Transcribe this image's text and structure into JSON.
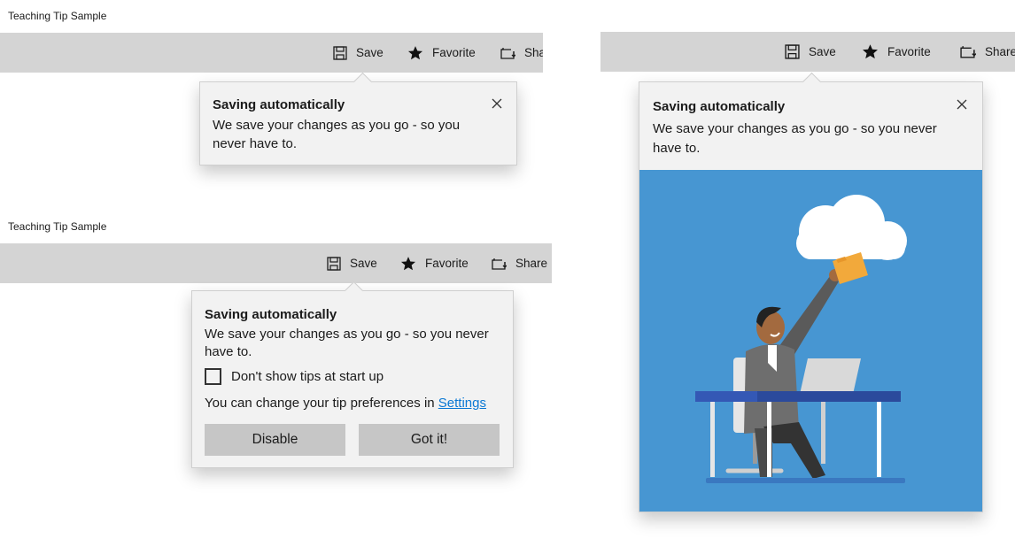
{
  "samples": [
    {
      "caption": "Teaching Tip Sample",
      "toolbar": {
        "items": [
          {
            "icon": "save-icon",
            "label": "Save"
          },
          {
            "icon": "star-icon",
            "label": "Favorite"
          },
          {
            "icon": "share-icon",
            "label": "Share"
          }
        ]
      },
      "tip": {
        "title": "Saving automatically",
        "subtitle": "We save your changes as you go - so you never have to.",
        "close_icon": "close-icon"
      }
    },
    {
      "caption": "Teaching Tip Sample",
      "toolbar": {
        "items": [
          {
            "icon": "save-icon",
            "label": "Save"
          },
          {
            "icon": "star-icon",
            "label": "Favorite"
          },
          {
            "icon": "share-icon",
            "label": "Share"
          }
        ]
      },
      "tip": {
        "title": "Saving automatically",
        "subtitle": "We save your changes as you go - so you never have to.",
        "checkbox_label": "Don't show tips at start up",
        "checkbox_checked": false,
        "pref_text": "You can change your tip preferences in ",
        "pref_link": "Settings",
        "action_button": "Disable",
        "close_button": "Got it!"
      }
    },
    {
      "toolbar": {
        "items": [
          {
            "icon": "save-icon",
            "label": "Save"
          },
          {
            "icon": "star-icon",
            "label": "Favorite"
          },
          {
            "icon": "share-icon",
            "label": "Share"
          }
        ]
      },
      "tip": {
        "title": "Saving automatically",
        "subtitle": "We save your changes as you go - so you never have to.",
        "close_icon": "close-icon",
        "hero_image": "person-uploading-folder-to-cloud-illustration"
      }
    }
  ],
  "colors": {
    "toolbar": "#d4d4d4",
    "tip_bg": "#f2f2f2",
    "button": "#c6c6c6",
    "link": "#0a78d4",
    "hero_bg": "#4796d2"
  }
}
